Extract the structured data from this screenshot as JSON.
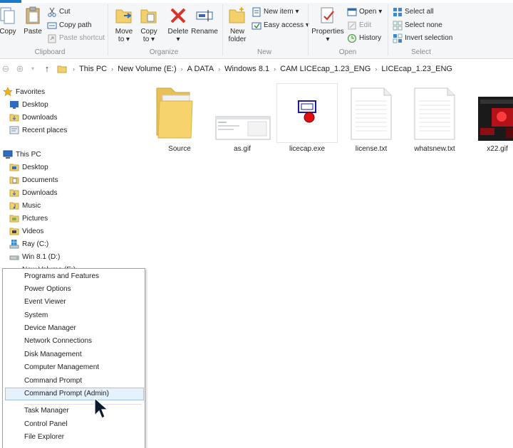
{
  "ribbon": {
    "clipboard": {
      "group_label": "Clipboard",
      "copy": "Copy",
      "paste": "Paste",
      "cut": "Cut",
      "copy_path": "Copy path",
      "paste_shortcut": "Paste shortcut"
    },
    "organize": {
      "group_label": "Organize",
      "move_to_1": "Move",
      "move_to_2": "to",
      "copy_to_1": "Copy",
      "copy_to_2": "to",
      "delete": "Delete",
      "rename": "Rename"
    },
    "new": {
      "group_label": "New",
      "new_folder_1": "New",
      "new_folder_2": "folder",
      "new_item": "New item",
      "easy_access": "Easy access"
    },
    "open": {
      "group_label": "Open",
      "properties": "Properties",
      "open": "Open",
      "edit": "Edit",
      "history": "History"
    },
    "select": {
      "group_label": "Select",
      "select_all": "Select all",
      "select_none": "Select none",
      "invert_selection": "Invert selection"
    }
  },
  "address": {
    "crumbs": [
      "This PC",
      "New Volume (E:)",
      "A DATA",
      "Windows 8.1",
      "CAM LICEcap_1.23_ENG",
      "LICEcap_1.23_ENG"
    ]
  },
  "nav": {
    "favorites": "Favorites",
    "desktop_fav": "Desktop",
    "downloads_fav": "Downloads",
    "recent_places": "Recent places",
    "this_pc": "This PC",
    "desktop": "Desktop",
    "documents": "Documents",
    "downloads": "Downloads",
    "music": "Music",
    "pictures": "Pictures",
    "videos": "Videos",
    "drive_c": "Ray (C:)",
    "drive_d": "Win 8.1 (D:)",
    "drive_e": "New Volume (E:)"
  },
  "files": [
    {
      "name": "Source",
      "type": "folder"
    },
    {
      "name": "as.gif",
      "type": "gif"
    },
    {
      "name": "licecap.exe",
      "type": "exe"
    },
    {
      "name": "license.txt",
      "type": "txt"
    },
    {
      "name": "whatsnew.txt",
      "type": "txt"
    },
    {
      "name": "x22.gif",
      "type": "gif"
    }
  ],
  "context_menu": {
    "items": [
      "Programs and Features",
      "Power Options",
      "Event Viewer",
      "System",
      "Device Manager",
      "Network Connections",
      "Disk Management",
      "Computer Management",
      "Command Prompt",
      "Command Prompt (Admin)",
      "Task Manager",
      "Control Panel",
      "File Explorer"
    ],
    "highlighted": "Command Prompt (Admin)"
  },
  "colors": {
    "ribbon_bg": "#f5f6f7",
    "accent_blue": "#1979ca",
    "folder_yellow": "#f3d06b",
    "menu_highlight": "#e5f1fb",
    "menu_highlight_border": "#9fc4ea"
  }
}
